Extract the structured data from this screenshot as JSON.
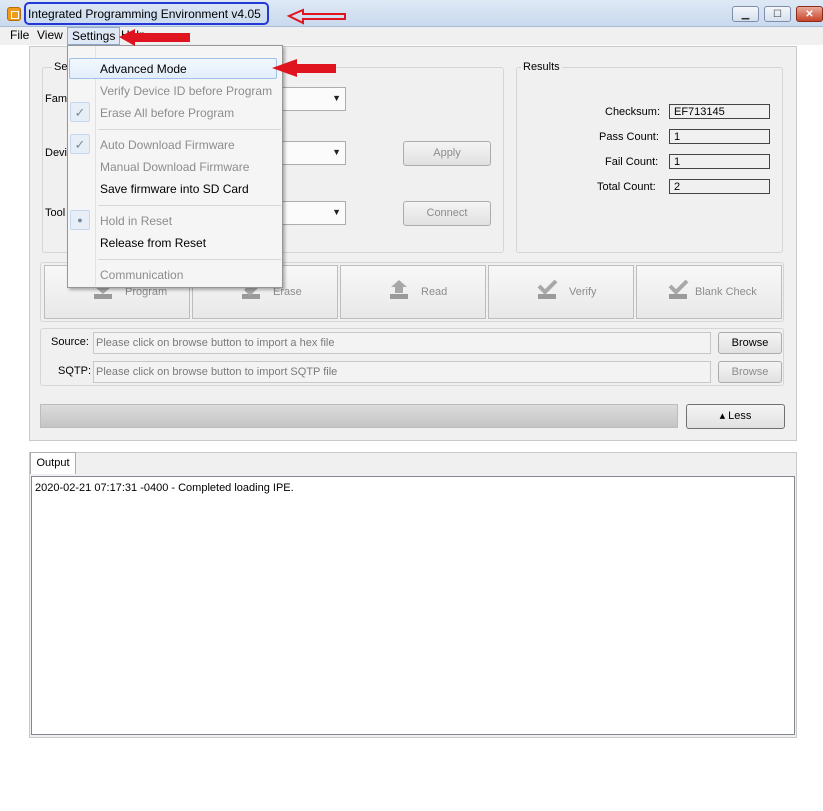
{
  "window": {
    "title": "Integrated Programming Environment v4.05",
    "minimize_glyph": "▁",
    "maximize_glyph": "☐",
    "close_glyph": "✕"
  },
  "menubar": {
    "items": [
      "File",
      "View",
      "Settings",
      "Help"
    ]
  },
  "settings_menu": {
    "items": [
      {
        "label": "Advanced Mode",
        "enabled": true,
        "highlighted": true
      },
      {
        "label": "Verify Device ID before Program",
        "enabled": false
      },
      {
        "label": "Erase All before Program",
        "enabled": false,
        "checked": true
      },
      {
        "label": "Auto Download Firmware",
        "enabled": false,
        "checked": true
      },
      {
        "label": "Manual Download Firmware",
        "enabled": false
      },
      {
        "label": "Save firmware into SD Card",
        "enabled": true
      },
      {
        "label": "Hold in Reset",
        "enabled": false,
        "radio": true
      },
      {
        "label": "Release from Reset",
        "enabled": true
      },
      {
        "label": "Communication",
        "enabled": false
      }
    ],
    "check_glyph": "✓",
    "radio_glyph": "●"
  },
  "selection": {
    "group_label": "Sel",
    "family_label": "Fam",
    "device_label": "Devi",
    "tool_label": "Tool",
    "apply_label": "Apply",
    "connect_label": "Connect"
  },
  "results": {
    "group_label": "Results",
    "checksum_label": "Checksum:",
    "checksum_value": "EF713145",
    "pass_label": "Pass Count:",
    "pass_value": "1",
    "fail_label": "Fail Count:",
    "fail_value": "1",
    "total_label": "Total Count:",
    "total_value": "2"
  },
  "actions": [
    {
      "label": "Program",
      "icon": "program-icon"
    },
    {
      "label": "Erase",
      "icon": "erase-icon"
    },
    {
      "label": "Read",
      "icon": "read-icon"
    },
    {
      "label": "Verify",
      "icon": "verify-icon"
    },
    {
      "label": "Blank Check",
      "icon": "blank-check-icon"
    }
  ],
  "source": {
    "label": "Source:",
    "placeholder": "Please click on browse button to import a hex file",
    "browse_label": "Browse"
  },
  "sqtp": {
    "label": "SQTP:",
    "placeholder": "Please click on browse button to import SQTP file",
    "browse_label": "Browse"
  },
  "less_button": "▴ Less",
  "output": {
    "tab_label": "Output",
    "log": "2020-02-21 07:17:31 -0400 - Completed loading IPE."
  },
  "annotation_colors": {
    "arrow": "#e0141e",
    "title_box": "#2338d6"
  }
}
